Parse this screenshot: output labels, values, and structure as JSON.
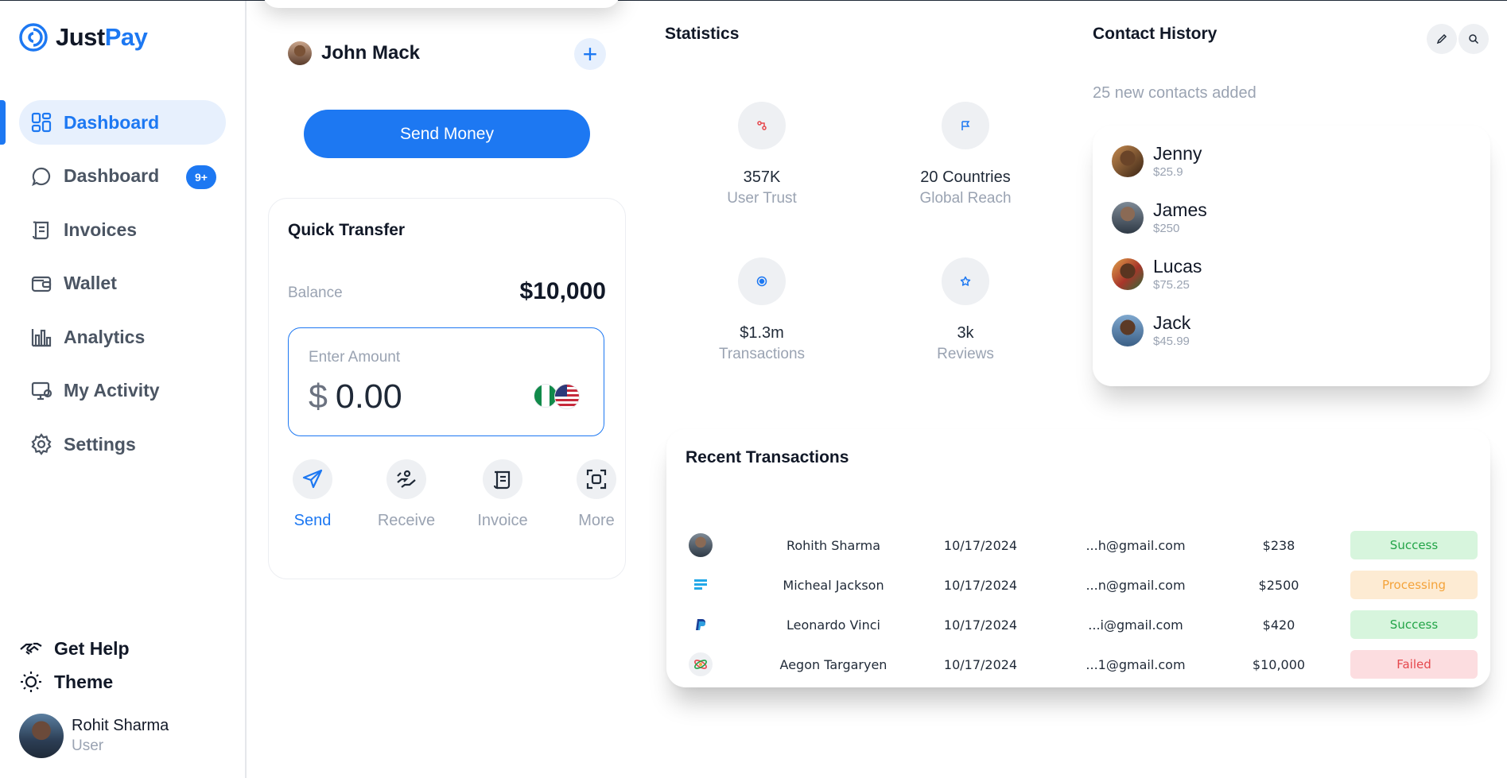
{
  "brand": {
    "name_part1": "Just",
    "name_part2": "Pay",
    "accent_color": "#1d78f2"
  },
  "sidebar": {
    "items": [
      {
        "label": "Dashboard",
        "icon": "dashboard-grid-icon",
        "active": true
      },
      {
        "label": "Dashboard",
        "icon": "chat-bubble-icon",
        "badge": "9+"
      },
      {
        "label": "Invoices",
        "icon": "invoice-scroll-icon"
      },
      {
        "label": "Wallet",
        "icon": "wallet-icon"
      },
      {
        "label": "Analytics",
        "icon": "bar-chart-icon"
      },
      {
        "label": "My Activity",
        "icon": "monitor-activity-icon"
      },
      {
        "label": "Settings",
        "icon": "gear-icon"
      }
    ],
    "help_label": "Get Help",
    "theme_label": "Theme",
    "user": {
      "name": "Rohit Sharma",
      "role": "User"
    }
  },
  "profile": {
    "name": "John Mack"
  },
  "send_money_label": "Send Money",
  "quick_transfer": {
    "title": "Quick Transfer",
    "balance_label": "Balance",
    "balance_value": "$10,000",
    "amount_label": "Enter Amount",
    "currency_symbol": "$",
    "amount_value": "0.00",
    "actions": [
      {
        "label": "Send",
        "icon": "send-icon"
      },
      {
        "label": "Receive",
        "icon": "receive-hand-icon"
      },
      {
        "label": "Invoice",
        "icon": "invoice-icon"
      },
      {
        "label": "More",
        "icon": "scan-icon"
      }
    ]
  },
  "statistics": {
    "title": "Statistics",
    "items": [
      {
        "value": "357K",
        "label": "User Trust",
        "icon": "user-trust-icon"
      },
      {
        "value": "20 Countries",
        "label": "Global Reach",
        "icon": "flag-icon"
      },
      {
        "value": "$1.3m",
        "label": "Transactions",
        "icon": "target-icon"
      },
      {
        "value": "3k",
        "label": "Reviews",
        "icon": "star-icon"
      }
    ]
  },
  "contact_history": {
    "title": "Contact History",
    "subtitle": "25 new contacts added",
    "contacts": [
      {
        "name": "Jenny",
        "amount": "$25.9"
      },
      {
        "name": "James",
        "amount": "$250"
      },
      {
        "name": "Lucas",
        "amount": "$75.25"
      },
      {
        "name": "Jack",
        "amount": "$45.99"
      }
    ]
  },
  "recent_transactions": {
    "title": "Recent Transactions",
    "rows": [
      {
        "name": "Rohith Sharma",
        "date": "10/17/2024",
        "email": "...h@gmail.com",
        "amount": "$238",
        "status": "Success",
        "icon": "avatar-icon"
      },
      {
        "name": "Micheal Jackson",
        "date": "10/17/2024",
        "email": "...n@gmail.com",
        "amount": "$2500",
        "status": "Processing",
        "icon": "stripe-lines-icon"
      },
      {
        "name": "Leonardo Vinci",
        "date": "10/17/2024",
        "email": "...i@gmail.com",
        "amount": "$420",
        "status": "Success",
        "icon": "paypal-icon"
      },
      {
        "name": "Aegon Targaryen",
        "date": "10/17/2024",
        "email": "...1@gmail.com",
        "amount": "$10,000",
        "status": "Failed",
        "icon": "atom-logo-icon"
      }
    ]
  }
}
